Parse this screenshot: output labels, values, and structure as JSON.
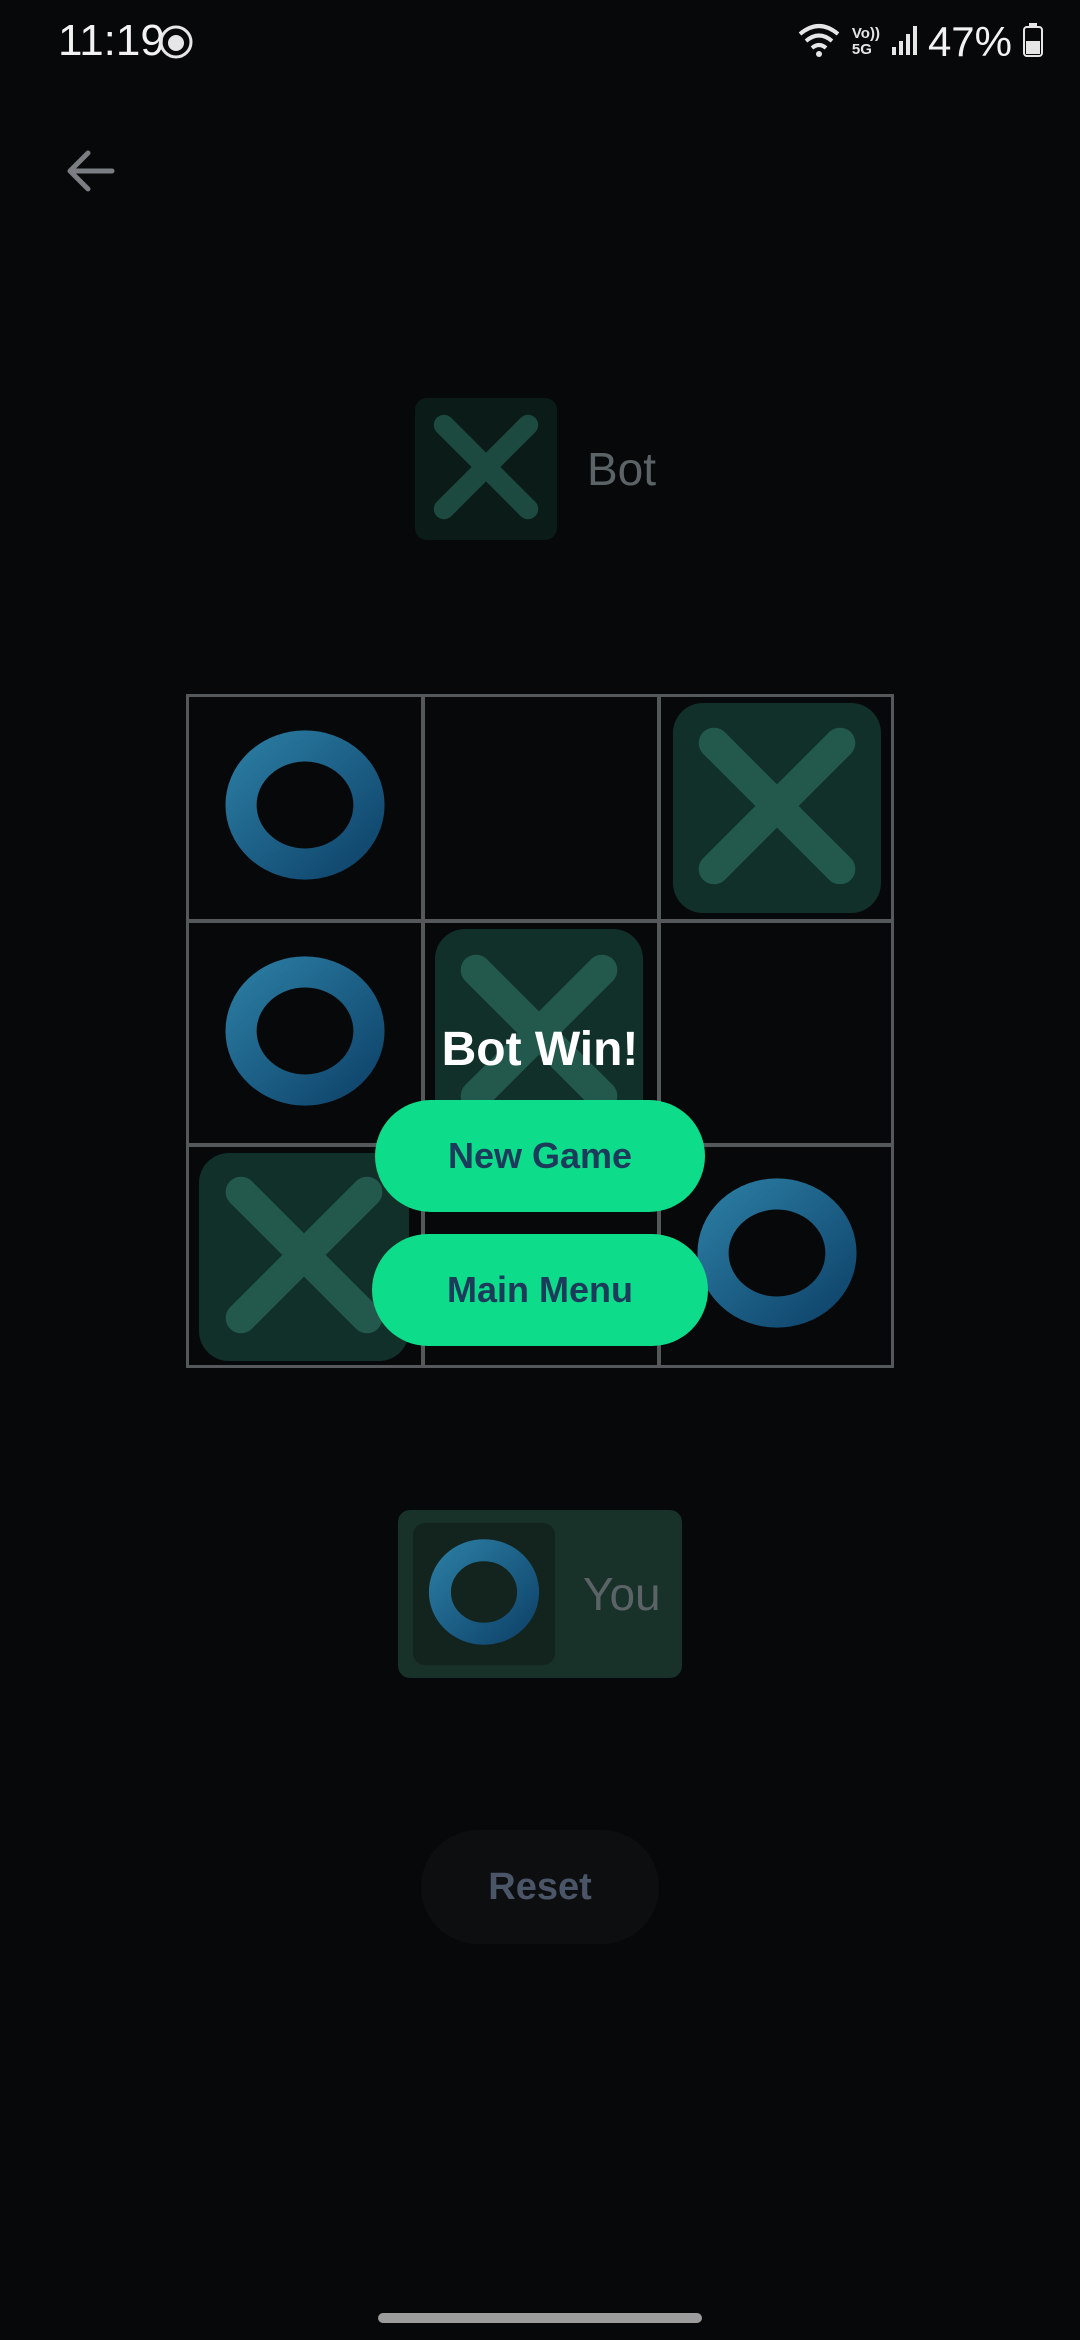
{
  "status_bar": {
    "time": "11:19",
    "network_label_top": "Vo))",
    "network_label_bottom": "5G",
    "battery": "47%"
  },
  "header": {
    "back_icon": "arrow-left-icon"
  },
  "players": {
    "bot": {
      "name": "Bot",
      "mark": "X"
    },
    "you": {
      "name": "You",
      "mark": "O"
    }
  },
  "board": {
    "cells": [
      [
        "O",
        "",
        "X"
      ],
      [
        "O",
        "X",
        ""
      ],
      [
        "X",
        "",
        "O"
      ]
    ]
  },
  "result": {
    "title": "Bot Win!",
    "new_game_label": "New Game",
    "main_menu_label": "Main Menu"
  },
  "controls": {
    "reset_label": "Reset"
  },
  "colors": {
    "background": "#07080a",
    "accent": "#0ddc8a",
    "x_mark": "#23594c",
    "o_mark": "#1b5e86"
  }
}
